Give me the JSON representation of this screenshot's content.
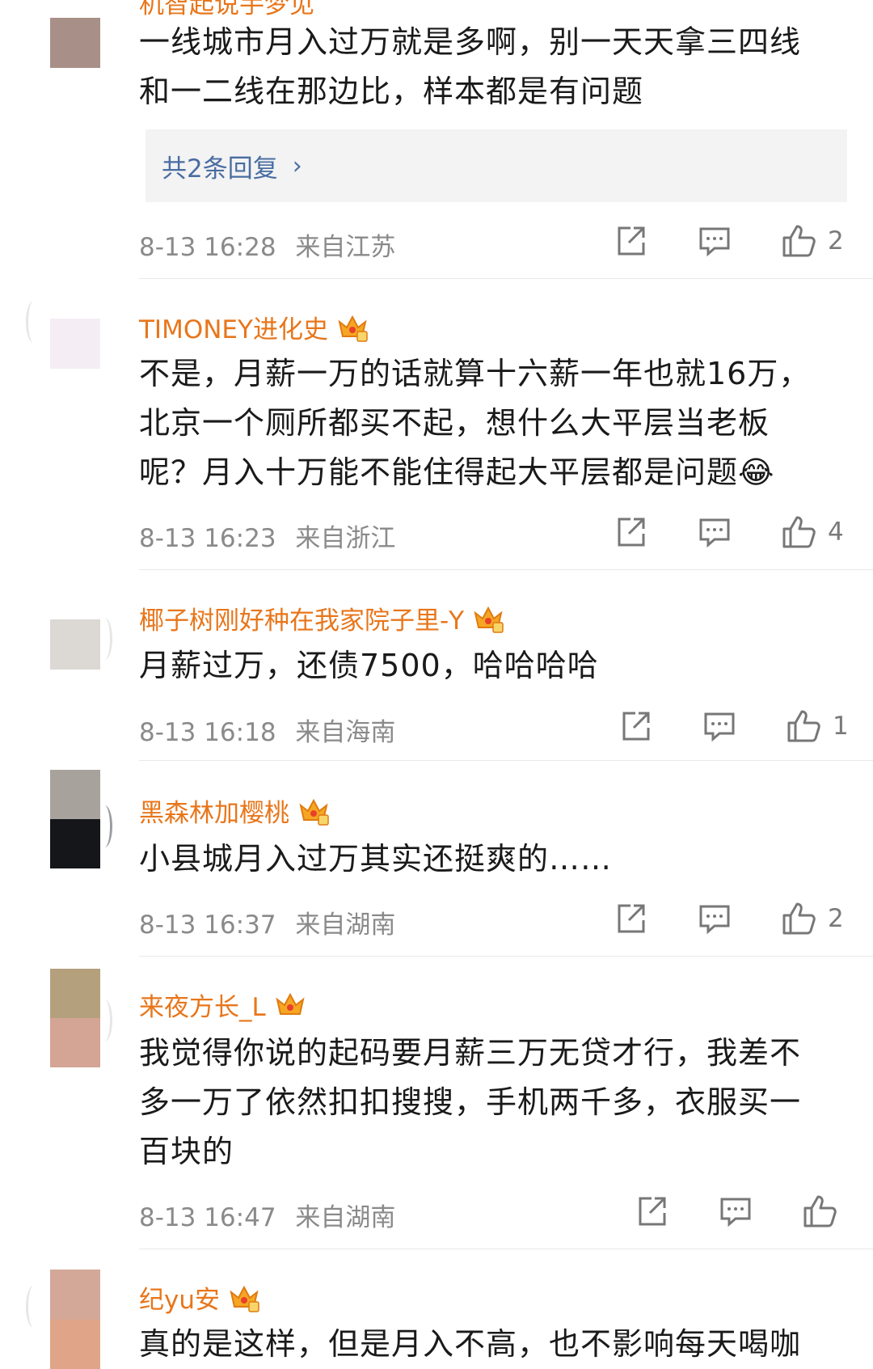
{
  "top_partial_name": "机智起说手梦见",
  "comments": [
    {
      "name": "",
      "text": "一线城市月入过万就是多啊，别一天天拿三四线\n和一二线在那边比，样本都是有问题",
      "replies_label": "共2条回复",
      "time": "8-13 16:28",
      "location": "来自江苏",
      "likes": "2",
      "avatar_colors": [
        "#a89088",
        "#a89088"
      ]
    },
    {
      "name": "TIMONEY进化史",
      "text": "不是，月薪一万的话就算十六薪一年也就16万，\n北京一个厕所都买不起，想什么大平层当老板\n呢？月入十万能不能住得起大平层都是问题😂",
      "time": "8-13 16:23",
      "location": "来自浙江",
      "likes": "4",
      "avatar_colors": [
        "#f4eef4",
        "#f4eef4"
      ]
    },
    {
      "name": "椰子树刚好种在我家院子里-Y",
      "text": "月薪过万，还债7500，哈哈哈哈",
      "time": "8-13 16:18",
      "location": "来自海南",
      "likes": "1",
      "avatar_colors": [
        "#dcd8d4",
        "#dcd8d4"
      ]
    },
    {
      "name": "黑森林加樱桃",
      "text": "小县城月入过万其实还挺爽的……",
      "time": "8-13 16:37",
      "location": "来自湖南",
      "likes": "2",
      "avatar_colors": [
        "#a8a29c",
        "#14161a"
      ]
    },
    {
      "name": "来夜方长_L",
      "text": "我觉得你说的起码要月薪三万无贷才行，我差不\n多一万了依然扣扣搜搜，手机两千多，衣服买一\n百块的",
      "time": "8-13 16:47",
      "location": "来自湖南",
      "likes": "",
      "avatar_colors": [
        "#b4a07c",
        "#d4a494"
      ]
    },
    {
      "name": "纪yu安",
      "text": "真的是这样，但是月入不高，也不影响每天喝咖",
      "avatar_colors": [
        "#d4a898",
        "#e0a488"
      ]
    }
  ],
  "icons": {
    "share": "share-icon",
    "comment": "comment-icon",
    "like": "like-icon",
    "crown": "vip-crown-icon"
  },
  "colors": {
    "name": "#e8761b",
    "link": "#4a6da2",
    "meta": "#8a8a8a"
  }
}
